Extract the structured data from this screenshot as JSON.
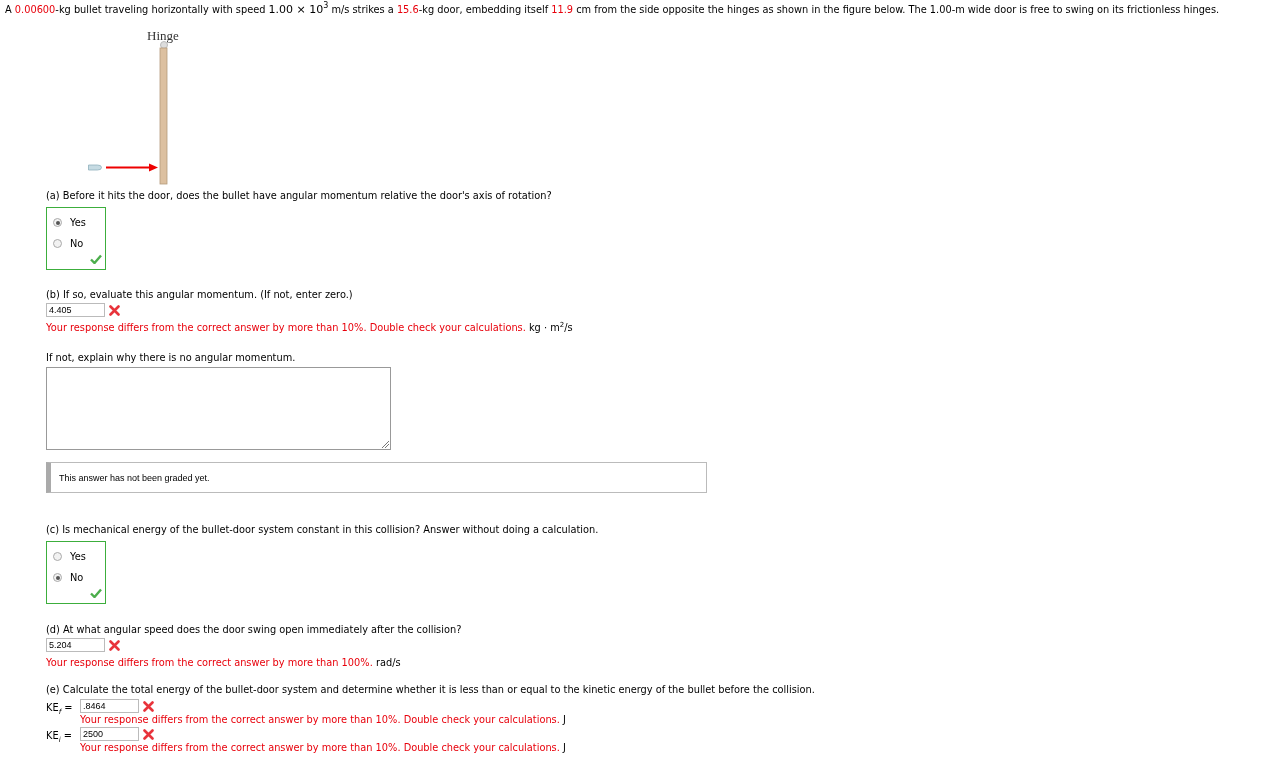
{
  "intro": [
    {
      "kind": "plain",
      "text": "A "
    },
    {
      "kind": "value",
      "text": "0.00600"
    },
    {
      "kind": "plain",
      "text": "-kg bullet traveling horizontally with speed "
    },
    {
      "kind": "math",
      "text": "1.00 × 10$^{3}$"
    },
    {
      "kind": "plain",
      "text": " m/s strikes a "
    },
    {
      "kind": "value",
      "text": "15.6"
    },
    {
      "kind": "plain",
      "text": "-kg door, embedding itself "
    },
    {
      "kind": "value",
      "text": "11.9"
    },
    {
      "kind": "plain",
      "text": " cm from the side opposite the hinges as shown in the figure below. The 1.00-m wide door is free to swing on its frictionless hinges."
    }
  ],
  "figure": {
    "label": "Hinge"
  },
  "parts": [
    {
      "kind": "choice",
      "question": "(a) Before it hits the door, does the bullet have angular momentum relative the door's axis of rotation?",
      "correct": true,
      "options": [
        {
          "label": "Yes",
          "selected": true
        },
        {
          "label": "No",
          "selected": false
        }
      ]
    },
    {
      "kind": "numeric",
      "question": "(b) If so, evaluate this angular momentum. (If not, enter zero.)",
      "value": "4.405",
      "correct": false,
      "feedback": "Your response differs from the correct answer by more than 10%. Double check your calculations.",
      "unit": "kg · m$^{2}$/s"
    },
    {
      "kind": "essay",
      "question": "If not, explain why there is no angular momentum.",
      "status": "This answer has not been graded yet."
    },
    {
      "kind": "choice",
      "question": "(c) Is mechanical energy of the bullet-door system constant in this collision? Answer without doing a calculation.",
      "correct": true,
      "options": [
        {
          "label": "Yes",
          "selected": false
        },
        {
          "label": "No",
          "selected": true
        }
      ]
    },
    {
      "kind": "numeric",
      "question": "(d) At what angular speed does the door swing open immediately after the collision?",
      "value": "5.204",
      "correct": false,
      "feedback": "Your response differs from the correct answer by more than 100%.",
      "unit": "rad/s"
    },
    {
      "kind": "energy",
      "question": "(e) Calculate the total energy of the bullet-door system and determine whether it is less than or equal to the kinetic energy of the bullet before the collision.",
      "rows": [
        {
          "symbol": "KE$_{f}$ =",
          "value": ".8464",
          "correct": false,
          "feedback": "Your response differs from the correct answer by more than 10%. Double check your calculations.",
          "unit": "J"
        },
        {
          "symbol": "KE$_{i}$ =",
          "value": "2500",
          "correct": false,
          "feedback": "Your response differs from the correct answer by more than 10%. Double check your calculations.",
          "unit": "J"
        }
      ]
    }
  ]
}
